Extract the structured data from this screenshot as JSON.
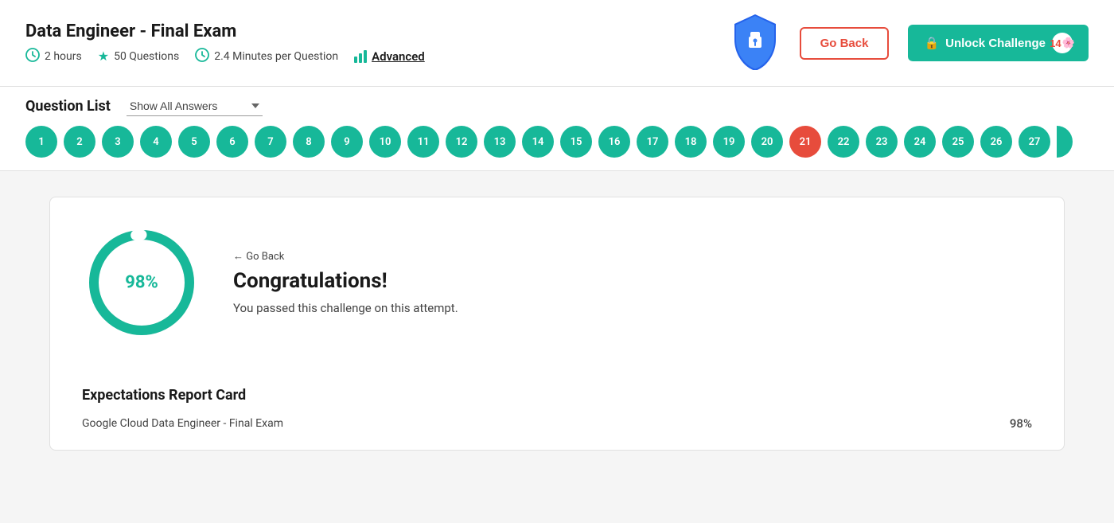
{
  "header": {
    "title": "Data Engineer - Final Exam",
    "meta": {
      "duration": "2 hours",
      "questions": "50 Questions",
      "minutes_per_question": "2.4 Minutes per Question",
      "difficulty": "Advanced"
    },
    "go_back_label": "Go Back",
    "unlock_label": "Unlock Challenge",
    "unlock_count": "14"
  },
  "question_bar": {
    "label": "Question List",
    "show_answers_label": "Show All Answers",
    "numbers": [
      1,
      2,
      3,
      4,
      5,
      6,
      7,
      8,
      9,
      10,
      11,
      12,
      13,
      14,
      15,
      16,
      17,
      18,
      19,
      20,
      21,
      22,
      23,
      24,
      25,
      26,
      27
    ],
    "wrong_number": 21
  },
  "congrats": {
    "go_back_link": "← Go Back",
    "title": "Congratulations!",
    "subtitle": "You passed this challenge on this attempt.",
    "percentage": 98
  },
  "report_card": {
    "title": "Expectations Report Card",
    "exam_name": "Google Cloud Data Engineer - Final Exam",
    "score": "98%"
  },
  "colors": {
    "teal": "#17b899",
    "red": "#e74c3c",
    "dark": "#1a1a1a",
    "gray": "#444"
  }
}
